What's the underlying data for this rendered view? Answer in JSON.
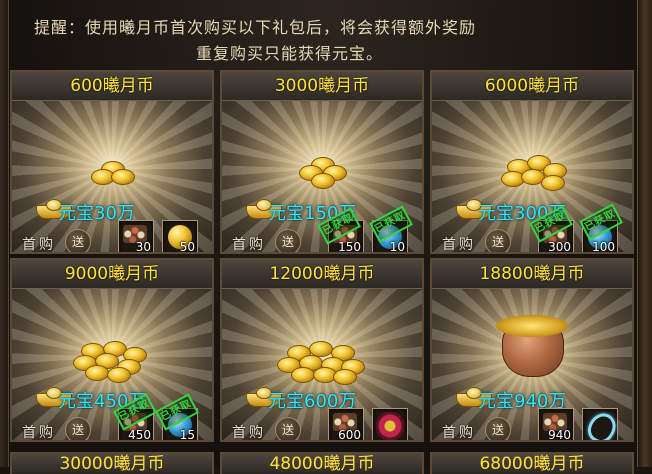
{
  "notice": {
    "line1": "提醒：使用曦月币首次购买以下礼包后，将会获得额外奖励",
    "line2": "重复购买只能获得元宝。"
  },
  "first_purchase_label": "首购",
  "gift_label": "送",
  "claimed_label": "已获取",
  "packs": [
    {
      "price": "600曦月币",
      "yuanbao": "元宝30万",
      "items": [
        {
          "icon": "material-pile-icon",
          "qty": "30"
        },
        {
          "icon": "gold-orb-icon",
          "qty": "50"
        }
      ],
      "claimed": false
    },
    {
      "price": "3000曦月币",
      "yuanbao": "元宝150万",
      "items": [
        {
          "icon": "material-pile-icon",
          "qty": "150"
        },
        {
          "icon": "blue-orb-icon",
          "qty": "10"
        }
      ],
      "claimed": true
    },
    {
      "price": "6000曦月币",
      "yuanbao": "元宝300万",
      "items": [
        {
          "icon": "material-pile-icon",
          "qty": "300"
        },
        {
          "icon": "blue-orb-icon",
          "qty": "100"
        }
      ],
      "claimed": true
    },
    {
      "price": "9000曦月币",
      "yuanbao": "元宝450万",
      "items": [
        {
          "icon": "material-pile-icon",
          "qty": "450"
        },
        {
          "icon": "blue-orb-icon",
          "qty": "15"
        }
      ],
      "claimed": true
    },
    {
      "price": "12000曦月币",
      "yuanbao": "元宝600万",
      "items": [
        {
          "icon": "material-pile-icon",
          "qty": "600"
        },
        {
          "icon": "red-gem-icon",
          "qty": ""
        }
      ],
      "claimed": false
    },
    {
      "price": "18800曦月币",
      "yuanbao": "元宝940万",
      "items": [
        {
          "icon": "material-pile-icon",
          "qty": "940"
        },
        {
          "icon": "ring-icon",
          "qty": ""
        }
      ],
      "claimed": false
    }
  ],
  "partial_row": [
    "30000曦月币",
    "48000曦月币",
    "68000曦月币"
  ],
  "colors": {
    "price": "#ffe13a",
    "yuanbao": "#2ee8ff",
    "claimed_stamp": "#35d441",
    "border": "#5c4a36"
  }
}
